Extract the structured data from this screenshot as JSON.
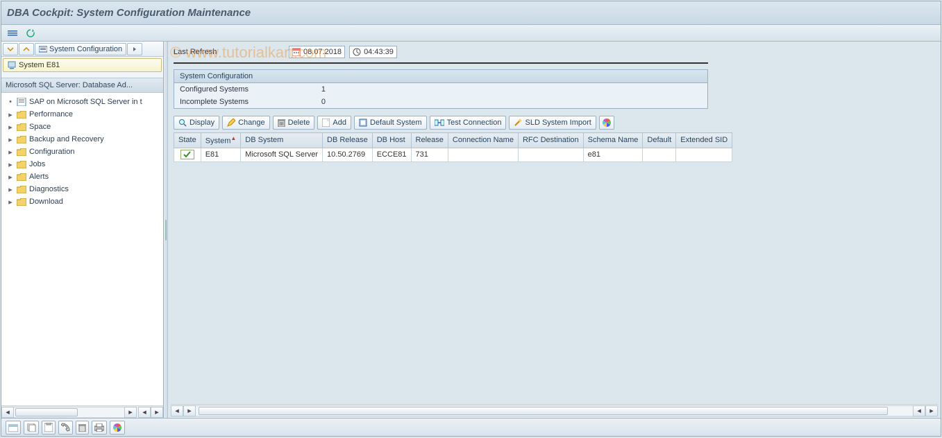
{
  "header": {
    "title": "DBA Cockpit: System Configuration Maintenance"
  },
  "watermark": "© www.tutorialkart.com",
  "sidebar": {
    "toolbar_label": "System Configuration",
    "system_label": "System E81",
    "tree_header": "Microsoft SQL Server: Database Ad...",
    "items": [
      {
        "label": "SAP on Microsoft SQL Server in t",
        "type": "doc"
      },
      {
        "label": "Performance",
        "type": "folder"
      },
      {
        "label": "Space",
        "type": "folder"
      },
      {
        "label": "Backup and Recovery",
        "type": "folder"
      },
      {
        "label": "Configuration",
        "type": "folder"
      },
      {
        "label": "Jobs",
        "type": "folder"
      },
      {
        "label": "Alerts",
        "type": "folder"
      },
      {
        "label": "Diagnostics",
        "type": "folder"
      },
      {
        "label": "Download",
        "type": "folder"
      }
    ]
  },
  "refresh": {
    "label": "Last Refresh",
    "date": "08.07.2018",
    "time": "04:43:39"
  },
  "panel": {
    "title": "System Configuration",
    "rows": [
      {
        "k": "Configured Systems",
        "v": "1"
      },
      {
        "k": "Incomplete Systems",
        "v": "0"
      }
    ]
  },
  "toolbar": {
    "display": "Display",
    "change": "Change",
    "delete": "Delete",
    "add": "Add",
    "default": "Default System",
    "test": "Test Connection",
    "sld": "SLD System Import"
  },
  "grid": {
    "cols": [
      "State",
      "System",
      "DB System",
      "DB Release",
      "DB Host",
      "Release",
      "Connection Name",
      "RFC Destination",
      "Schema Name",
      "Default",
      "Extended SID"
    ],
    "rows": [
      {
        "state": "ok",
        "system": "E81",
        "dbsystem": "Microsoft SQL Server",
        "dbrelease": "10.50.2769",
        "dbhost": "ECCE81",
        "release": "731",
        "conn": "",
        "rfc": "",
        "schema": "e81",
        "default": "",
        "extsid": ""
      }
    ]
  }
}
